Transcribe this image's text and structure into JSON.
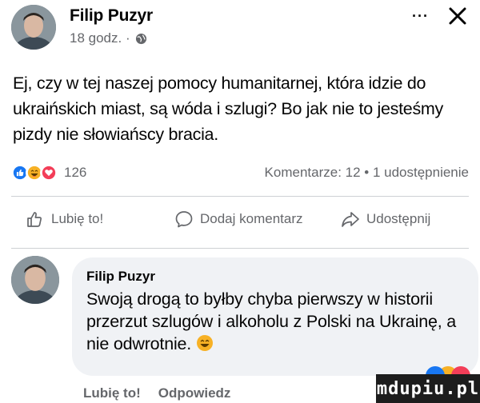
{
  "post": {
    "author": "Filip Puzyr",
    "time": "18 godz. ·",
    "more": "···",
    "text": "Ej, czy w tej naszej pomocy humanitarnej, która idzie do ukraińskich miast, są wóda i szlugi? Bo jak nie to jesteśmy pizdy nie słowiańscy bracia.",
    "reaction_count": "126",
    "stats": "Komentarze: 12 • 1 udostępnienie",
    "reactions": [
      "like-icon",
      "laugh-icon",
      "love-icon"
    ]
  },
  "actions": {
    "like": "Lubię to!",
    "comment": "Dodaj komentarz",
    "share": "Udostępnij"
  },
  "comment": {
    "author": "Filip Puzyr",
    "text": "Swoją drogą to byłby chyba pierwszy w historii przerzut szlugów i alkoholu z Polski na Ukrainę, a nie odwrotnie.",
    "like": "Lubię to!",
    "reply": "Odpowiedz"
  },
  "watermark": "mdupiu.pl",
  "colors": {
    "text": "#050505",
    "secondary": "#65676b",
    "bubble": "#f0f2f5",
    "like_blue": "#1877f2",
    "love_red": "#f33e58",
    "haha_yellow": "#f7b125"
  }
}
